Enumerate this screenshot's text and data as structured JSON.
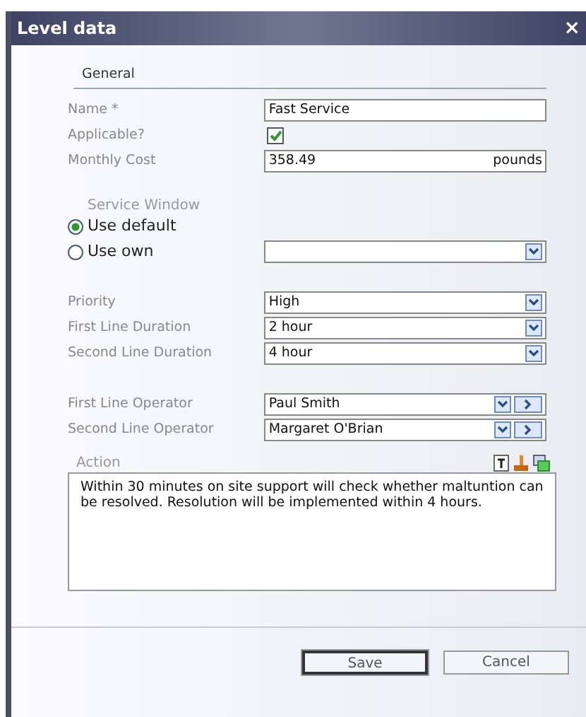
{
  "window": {
    "title": "Level data",
    "close": "×"
  },
  "section": "General",
  "fields": [
    {
      "kind": "text",
      "label": "Name *",
      "value": "Fast Service"
    },
    {
      "kind": "checkbox",
      "label": "Applicable?",
      "checked": true
    },
    {
      "kind": "text",
      "label": "Monthly Cost",
      "value": "358.49",
      "suffix": "pounds"
    }
  ],
  "service_window": {
    "legend": "Service Window",
    "options": [
      {
        "label": "Use default",
        "selected": true
      },
      {
        "label": "Use own",
        "selected": false
      }
    ]
  },
  "durations": [
    {
      "label": "Priority",
      "value": "High"
    },
    {
      "label": "First Line Duration",
      "value": "2 hour"
    },
    {
      "label": "Second Line Duration",
      "value": "4 hour"
    }
  ],
  "operators": [
    {
      "label": "First Line Operator",
      "value": "Paul Smith"
    },
    {
      "label": "Second Line Operator",
      "value": "Margaret O'Brian"
    }
  ],
  "action": {
    "legend": "Action",
    "text": "Within 30 minutes on site support will check whether maltuntion can be resolved. Resolution will be implemented within 4 hours."
  },
  "buttons": [
    {
      "label": "Save",
      "default": true
    },
    {
      "label": "Cancel",
      "default": false
    }
  ]
}
